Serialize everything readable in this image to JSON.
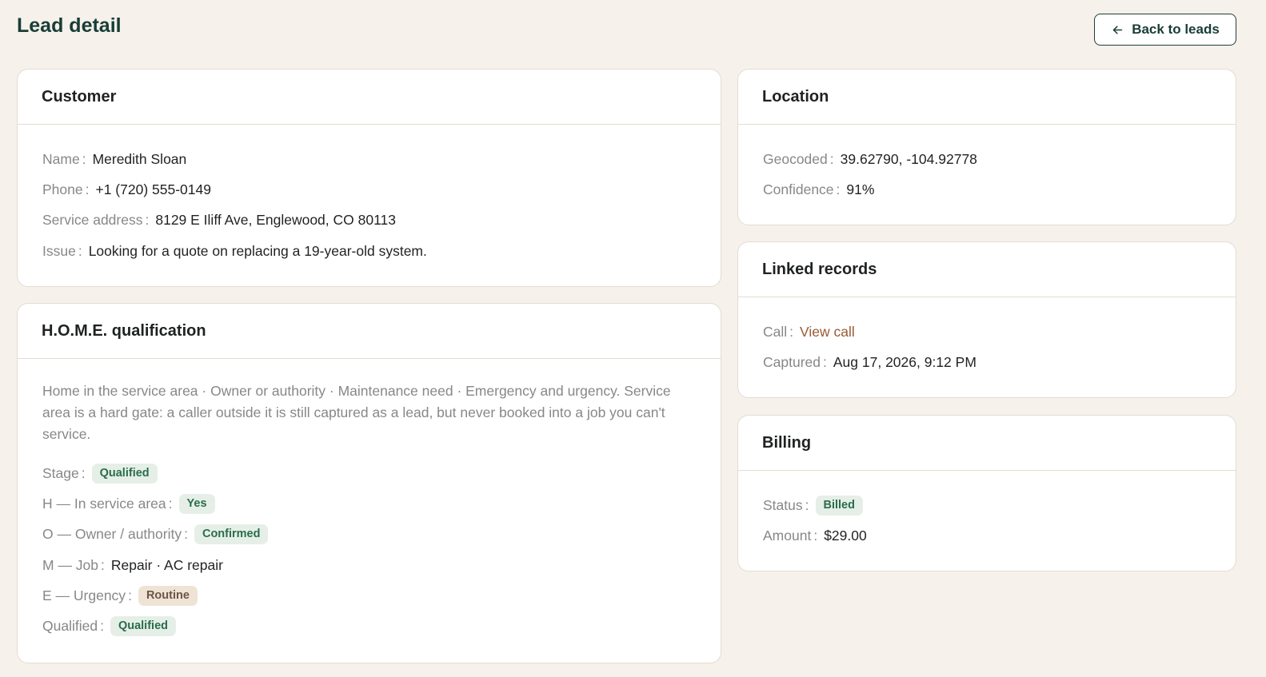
{
  "page": {
    "title": "Lead detail",
    "back_label": "Back to leads"
  },
  "customer": {
    "title": "Customer",
    "name_label": "Name",
    "name": "Meredith Sloan",
    "phone_label": "Phone",
    "phone": "+1 (720) 555-0149",
    "address_label": "Service address",
    "address": "8129 E Iliff Ave, Englewood, CO 80113",
    "issue_label": "Issue",
    "issue": "Looking for a quote on replacing a 19-year-old system."
  },
  "qualification": {
    "title": "H.O.M.E. qualification",
    "description": "Home in the service area · Owner or authority · Maintenance need · Emergency and urgency. Service area is a hard gate: a caller outside it is still captured as a lead, but never booked into a job you can't service.",
    "stage_label": "Stage",
    "stage": "Qualified",
    "h_label": "H — In service area",
    "h_value": "Yes",
    "o_label": "O — Owner / authority",
    "o_value": "Confirmed",
    "m_label": "M — Job",
    "m_value": "Repair · AC repair",
    "e_label": "E — Urgency",
    "e_value": "Routine",
    "qualified_label": "Qualified",
    "qualified_value": "Qualified"
  },
  "location": {
    "title": "Location",
    "geocoded_label": "Geocoded",
    "geocoded": "39.62790, -104.92778",
    "confidence_label": "Confidence",
    "confidence": "91%"
  },
  "linked": {
    "title": "Linked records",
    "call_label": "Call",
    "call_link": "View call",
    "captured_label": "Captured",
    "captured": "Aug 17, 2026, 9:12 PM"
  },
  "billing": {
    "title": "Billing",
    "status_label": "Status",
    "status": "Billed",
    "amount_label": "Amount",
    "amount": "$29.00"
  },
  "colors": {
    "background": "#f6f1eb",
    "heading": "#183d36",
    "link": "#9a5a36",
    "badge_green_bg": "#e6efe7",
    "badge_green_text": "#2a6d4b",
    "badge_tan_bg": "#efe3d5",
    "badge_tan_text": "#6b5545"
  },
  "icons": {
    "back": "arrow-left-icon"
  }
}
